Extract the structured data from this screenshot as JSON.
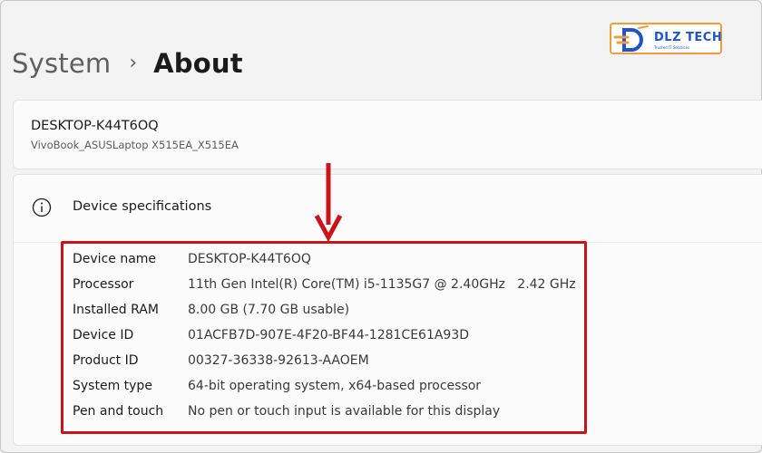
{
  "breadcrumb": {
    "parent": "System",
    "separator": "›",
    "current": "About"
  },
  "logo": {
    "text": "DLZ TECH",
    "tagline": "Trusted IT Solutions"
  },
  "device": {
    "name": "DESKTOP-K44T6OQ",
    "model": "VivoBook_ASUSLaptop X515EA_X515EA"
  },
  "specs": {
    "title": "Device specifications",
    "rows": [
      {
        "label": "Device name",
        "value": "DESKTOP-K44T6OQ"
      },
      {
        "label": "Processor",
        "value": "11th Gen Intel(R) Core(TM) i5-1135G7 @ 2.40GHz   2.42 GHz"
      },
      {
        "label": "Installed RAM",
        "value": "8.00 GB (7.70 GB usable)"
      },
      {
        "label": "Device ID",
        "value": "01ACFB7D-907E-4F20-BF44-1281CE61A93D"
      },
      {
        "label": "Product ID",
        "value": "00327-36338-92613-AAOEM"
      },
      {
        "label": "System type",
        "value": "64-bit operating system, x64-based processor"
      },
      {
        "label": "Pen and touch",
        "value": "No pen or touch input is available for this display"
      }
    ]
  },
  "colors": {
    "highlight": "#c9141a",
    "logo_blue": "#1f55c9",
    "logo_orange": "#f39c3c"
  }
}
